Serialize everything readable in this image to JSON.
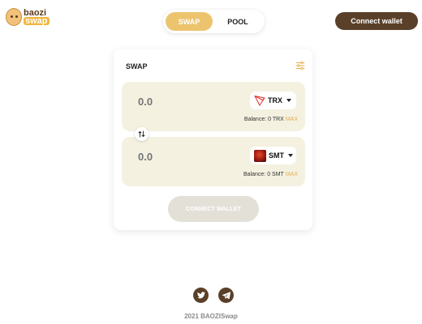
{
  "header": {
    "logo": {
      "line1": "baozi",
      "line2": "swap"
    },
    "tabs": [
      {
        "label": "SWAP",
        "active": true
      },
      {
        "label": "POOL",
        "active": false
      }
    ],
    "connect_label": "Connect wallet"
  },
  "card": {
    "title": "SWAP",
    "from": {
      "placeholder": "0.0",
      "token": "TRX",
      "balance_label": "Balance: 0 TRX",
      "max_label": "MAX"
    },
    "to": {
      "placeholder": "0.0",
      "token": "SMT",
      "balance_label": "Balance: 0 SMT",
      "max_label": "MAX"
    },
    "connect_label": "CONNECT WALLET"
  },
  "footer": {
    "copyright": "2021 BAOZISwap",
    "social": [
      "twitter-icon",
      "telegram-icon"
    ]
  },
  "colors": {
    "accent": "#ecc46e",
    "brown": "#5a4029",
    "panel": "#f4f1e1",
    "max": "#e6b04a"
  }
}
